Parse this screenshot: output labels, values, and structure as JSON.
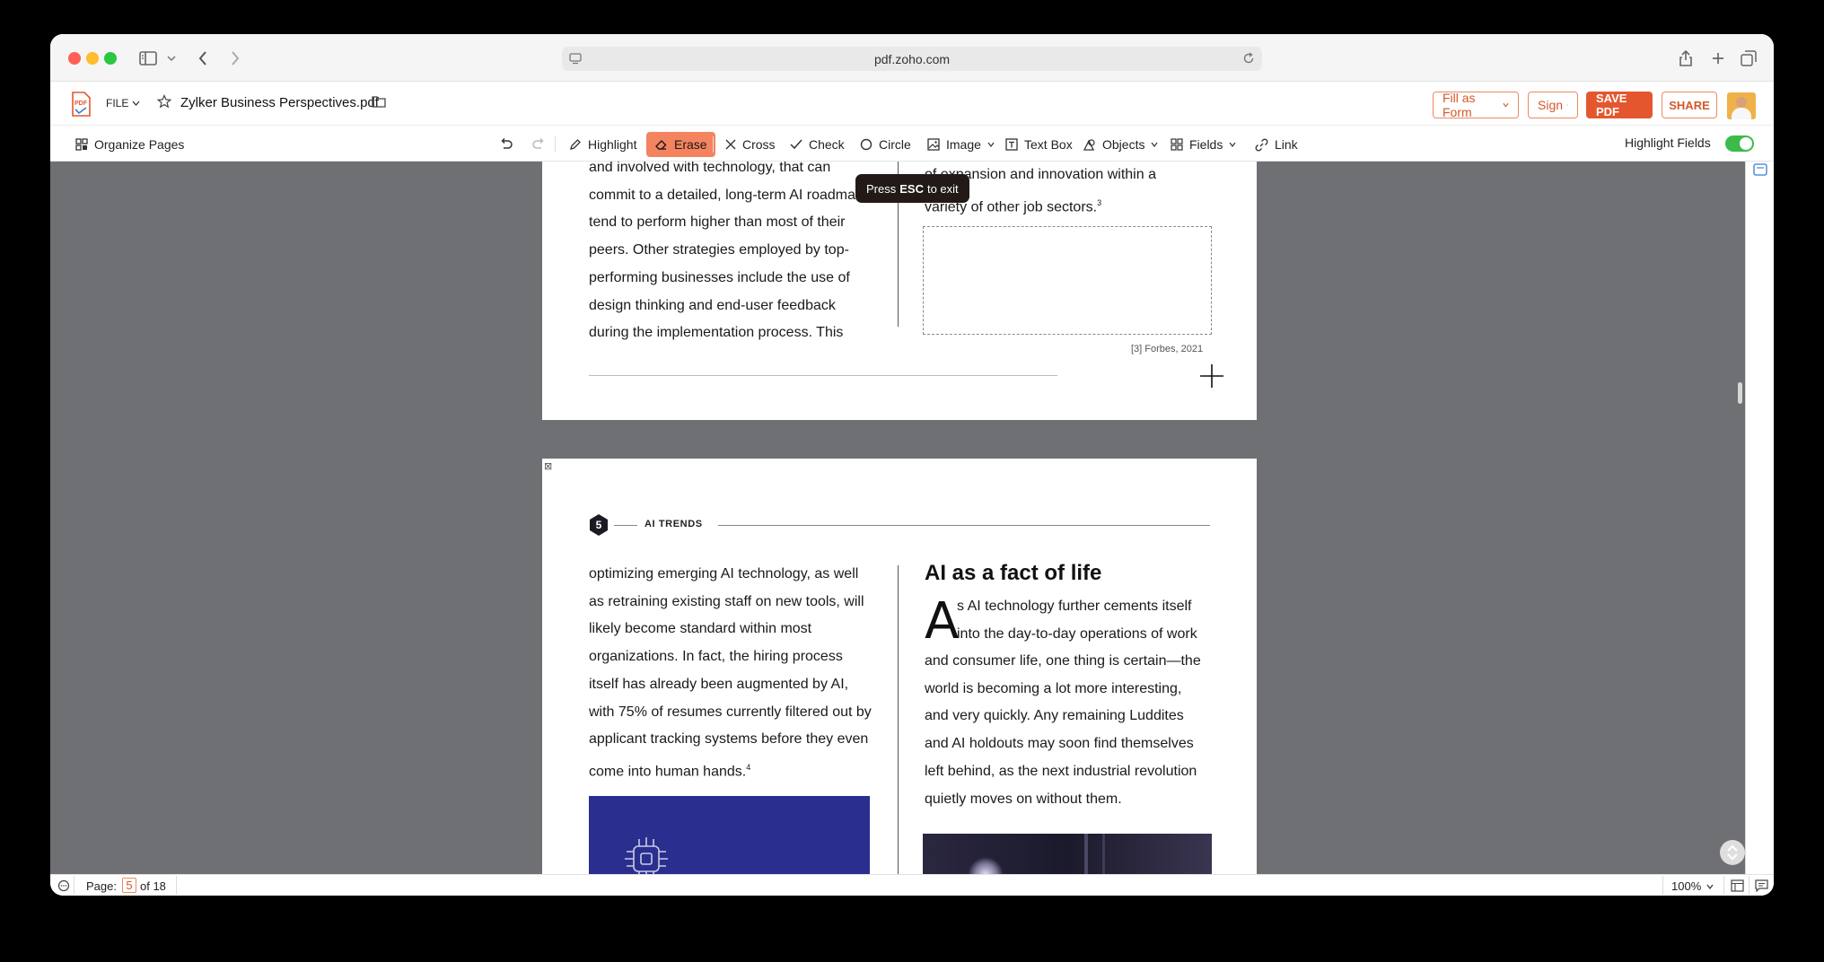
{
  "browser": {
    "url": "pdf.zoho.com"
  },
  "app": {
    "file_menu": "FILE",
    "file_name": "Zylker Business Perspectives.pdf",
    "fill_as_form": "Fill as Form",
    "sign": "Sign",
    "save_pdf": "SAVE PDF",
    "share": "SHARE"
  },
  "toolbar": {
    "organize_pages": "Organize Pages",
    "highlight": "Highlight",
    "erase": "Erase",
    "cross": "Cross",
    "check": "Check",
    "circle": "Circle",
    "image": "Image",
    "text_box": "Text Box",
    "objects": "Objects",
    "fields": "Fields",
    "link": "Link",
    "highlight_fields": "Highlight Fields",
    "highlight_fields_on": true
  },
  "tooltip": {
    "prefix": "Press",
    "key": "ESC",
    "suffix": "to exit"
  },
  "page4": {
    "left_lines": [
      "and involved with technology, that can",
      "commit to a detailed, long-term AI roadma",
      "tend to perform higher than most of their",
      "peers. Other strategies employed by top-",
      "performing businesses include the use of",
      "design thinking and end-user feedback",
      "during the implementation process. This"
    ],
    "right_lines": [
      "of expansion and innovation within a",
      "variety of other job sectors."
    ],
    "right_sup": "3",
    "citation": "[3] Forbes, 2021"
  },
  "page5": {
    "section_number": "5",
    "section_label": "AI TRENDS",
    "left_lines": [
      "optimizing emerging AI technology, as well",
      "as retraining existing staff on new tools, will",
      "likely become standard within most",
      "organizations. In fact, the hiring process",
      "itself has already been augmented by AI,",
      "with 75% of resumes currently filtered out by",
      "applicant tracking systems before they even",
      "come into human hands."
    ],
    "left_sup": "4",
    "heading": "AI as a fact of life",
    "drop_cap": "A",
    "right_lines_indented": [
      "s AI technology further cements itself",
      "into the day-to-day operations of work"
    ],
    "right_lines": [
      "and consumer life, one thing is certain—the",
      "world is becoming a lot more interesting,",
      "and very quickly. Any remaining Luddites",
      "and AI holdouts may soon find themselves",
      "left behind, as the next industrial revolution",
      "quietly moves on without them."
    ]
  },
  "status": {
    "page_label": "Page:",
    "current_page": "5",
    "of_pages": "of 18",
    "zoom": "100%"
  },
  "colors": {
    "accent": "#e4572e",
    "toggle": "#3cbb4a",
    "chip_blue": "#2a2f8f"
  }
}
